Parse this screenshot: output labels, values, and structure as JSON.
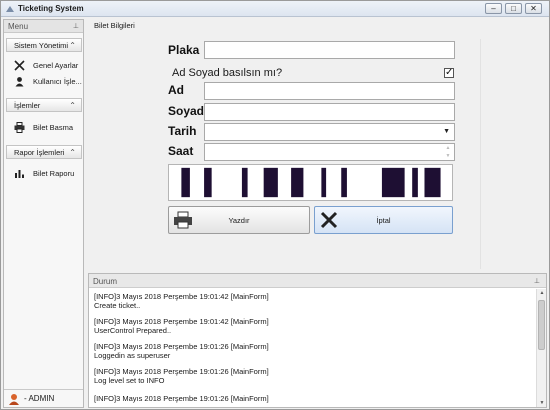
{
  "window": {
    "title": "Ticketing System"
  },
  "sidebar": {
    "header": "Menu",
    "groups": [
      {
        "label": "Sistem Yönetimi",
        "items": [
          "Genel Ayarlar",
          "Kullanıcı İşle..."
        ]
      },
      {
        "label": "İşlemler",
        "items": [
          "Bilet Basma"
        ]
      },
      {
        "label": "Rapor İşlemleri",
        "items": [
          "Bilet Raporu"
        ]
      }
    ],
    "user": "ADMIN"
  },
  "form": {
    "panel_title": "Bilet Bilgileri",
    "plaka_label": "Plaka",
    "plaka_value": "",
    "adsoyad_check_label": "Ad Soyad basılsın mı?",
    "adsoyad_checked": true,
    "ad_label": "Ad",
    "ad_value": "",
    "soyad_label": "Soyad",
    "soyad_value": "",
    "tarih_label": "Tarih",
    "tarih_value": "",
    "saat_label": "Saat",
    "saat_value": "",
    "print_label": "Yazdır",
    "cancel_label": "İptal"
  },
  "log": {
    "header": "Durum",
    "entries": [
      {
        "line1": "[INFO]3 Mayıs 2018 Perşembe 19:01:42 [MainForm]",
        "line2": "Create ticket.."
      },
      {
        "line1": "[INFO]3 Mayıs 2018 Perşembe 19:01:42 [MainForm]",
        "line2": "UserControl Prepared.."
      },
      {
        "line1": "[INFO]3 Mayıs 2018 Perşembe 19:01:26 [MainForm]",
        "line2": "Loggedin as superuser"
      },
      {
        "line1": "[INFO]3 Mayıs 2018 Perşembe 19:01:26 [MainForm]",
        "line2": " Log level set to INFO"
      },
      {
        "line1": "[INFO]3 Mayıs 2018 Perşembe 19:01:26 [MainForm]",
        "line2": ""
      }
    ]
  },
  "colors": {
    "barcode": "#1e0f33",
    "accent": "#7aa0cf"
  }
}
